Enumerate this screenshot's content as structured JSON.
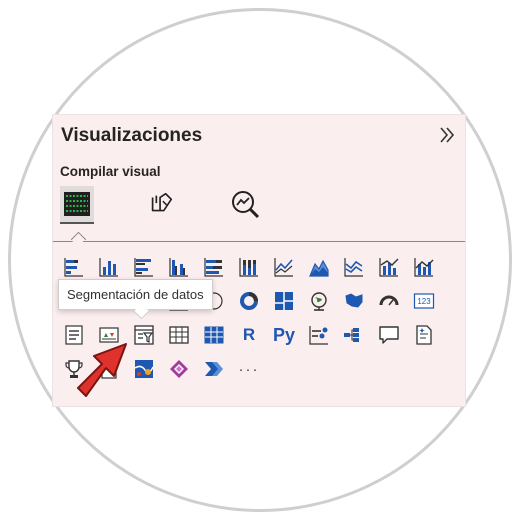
{
  "panel": {
    "title": "Visualizaciones",
    "expand_icon": "double-chevron-right-icon",
    "subtitle": "Compilar visual",
    "modes": [
      "build-visual-icon",
      "format-visual-icon",
      "analytics-icon"
    ]
  },
  "tooltip": {
    "text": "Segmentación de datos"
  },
  "visuals": {
    "r_label": "R",
    "py_label": "Py",
    "card_label": "123",
    "more_label": "···"
  },
  "colors": {
    "accent_blue": "#1f58b0",
    "accent_green": "#2e7d32",
    "panel_bg": "#fbeeef",
    "arrow_red": "#e0322d"
  }
}
